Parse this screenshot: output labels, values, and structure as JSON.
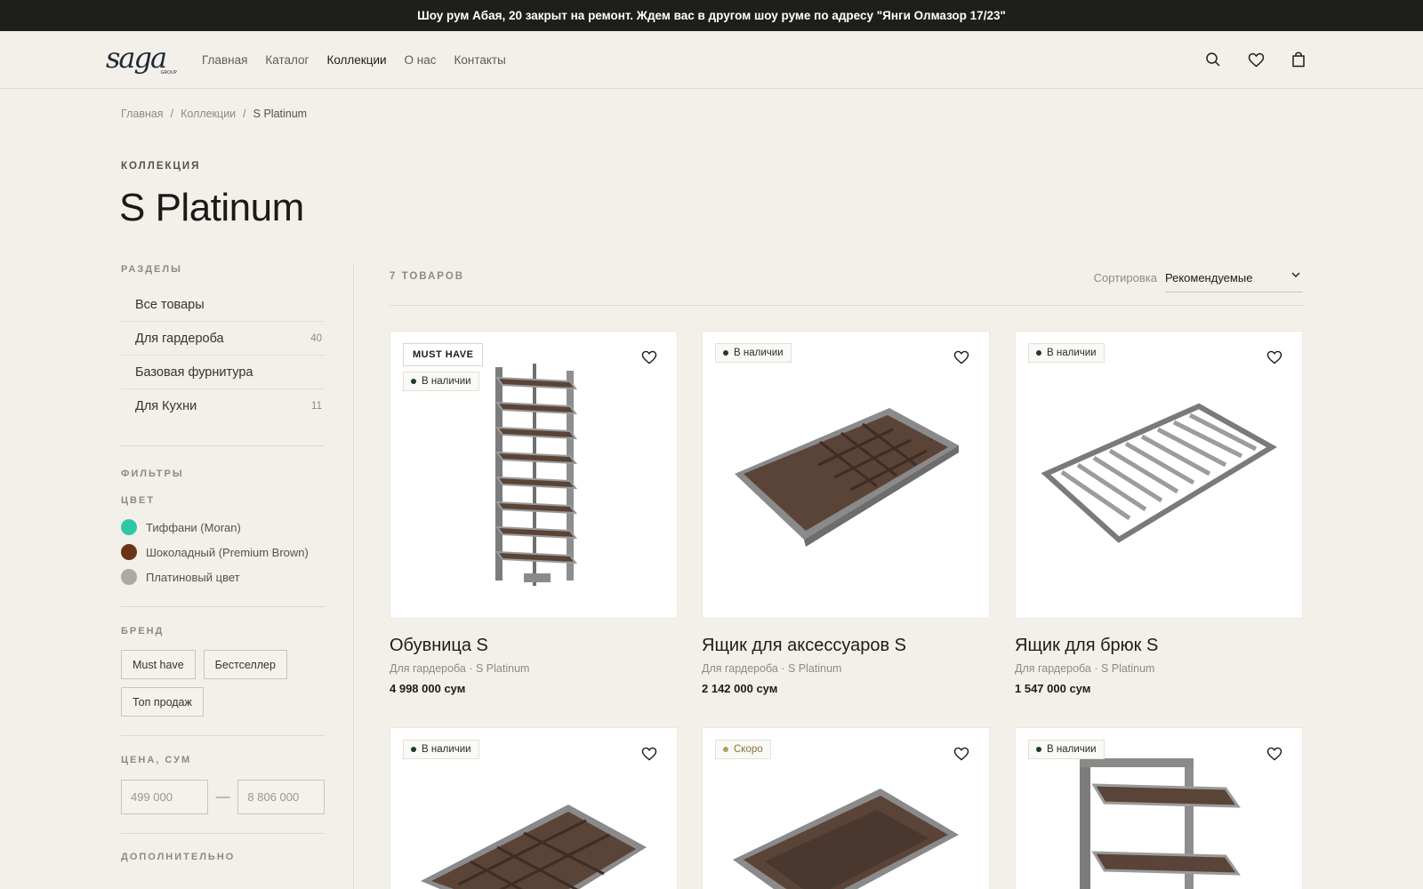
{
  "announcement": "Шоу рум Абая, 20 закрыт на ремонт. Ждем вас в другом шоу руме по адресу \"Янги Олмазор 17/23\"",
  "header": {
    "logo": "saga",
    "logo_sub": "GROUP",
    "nav": [
      "Главная",
      "Каталог",
      "Коллекции",
      "О нас",
      "Контакты"
    ],
    "icons": [
      "search-icon",
      "heart-icon",
      "bag-icon"
    ]
  },
  "breadcrumb": [
    "Главная",
    "/",
    "Коллекции",
    "/",
    "S Platinum"
  ],
  "page": {
    "eyebrow": "КОЛЛЕКЦИЯ",
    "title": "S Platinum"
  },
  "sidebar": {
    "sections_label": "РАЗДЕЛЫ",
    "sections": [
      {
        "label": "Все товары",
        "count": ""
      },
      {
        "label": "Для гардероба",
        "count": "40"
      },
      {
        "label": "Базовая фурнитура",
        "count": ""
      },
      {
        "label": "Для Кухни",
        "count": "11"
      }
    ],
    "filters_label": "ФИЛЬТРЫ",
    "color_label": "ЦВЕТ",
    "colors": [
      {
        "label": "Тиффани (Moran)",
        "hex": "#2ec8a6"
      },
      {
        "label": "Шоколадный (Premium Brown)",
        "hex": "#6b3416"
      },
      {
        "label": "Платиновый цвет",
        "hex": "#a9a9a9"
      }
    ],
    "brand_label": "БРЕНД",
    "brands": [
      "Must have",
      "Бестселлер",
      "Топ продаж"
    ],
    "price_label": "ЦЕНА, СУМ",
    "price_min_placeholder": "499 000",
    "price_max_placeholder": "8 806 000",
    "price_dash": "—",
    "extra_label": "ДОПОЛНИТЕЛЬНО"
  },
  "toolbar": {
    "count": "7 ТОВАРОВ",
    "sort_label": "Сортировка",
    "sort_value": "Рекомендуемые"
  },
  "products": [
    {
      "name": "Обувница S",
      "meta": "Для гардероба · S Platinum",
      "price": "4 998 000 сум",
      "badge_top": "MUST HAVE",
      "status": "В наличии",
      "status_color": "#1f3a33"
    },
    {
      "name": "Ящик для аксессуаров S",
      "meta": "Для гардероба · S Platinum",
      "price": "2 142 000 сум",
      "badge_top": "",
      "status": "В наличии",
      "status_color": "#1f3a33"
    },
    {
      "name": "Ящик для брюк S",
      "meta": "Для гардероба · S Platinum",
      "price": "1 547 000 сум",
      "badge_top": "",
      "status": "В наличии",
      "status_color": "#1f3a33"
    },
    {
      "name": "",
      "meta": "",
      "price": "",
      "badge_top": "",
      "status": "В наличии",
      "status_color": "#1f3a33"
    },
    {
      "name": "",
      "meta": "",
      "price": "",
      "badge_top": "",
      "status": "Скоро",
      "status_color": "#b89a63"
    },
    {
      "name": "",
      "meta": "",
      "price": "",
      "badge_top": "",
      "status": "В наличии",
      "status_color": "#1f3a33"
    }
  ],
  "colors": {
    "background": "#f3f0ea",
    "announcement_bg": "#1e1f1b",
    "brown": "#5a4337",
    "frame": "#8a8a8a"
  }
}
